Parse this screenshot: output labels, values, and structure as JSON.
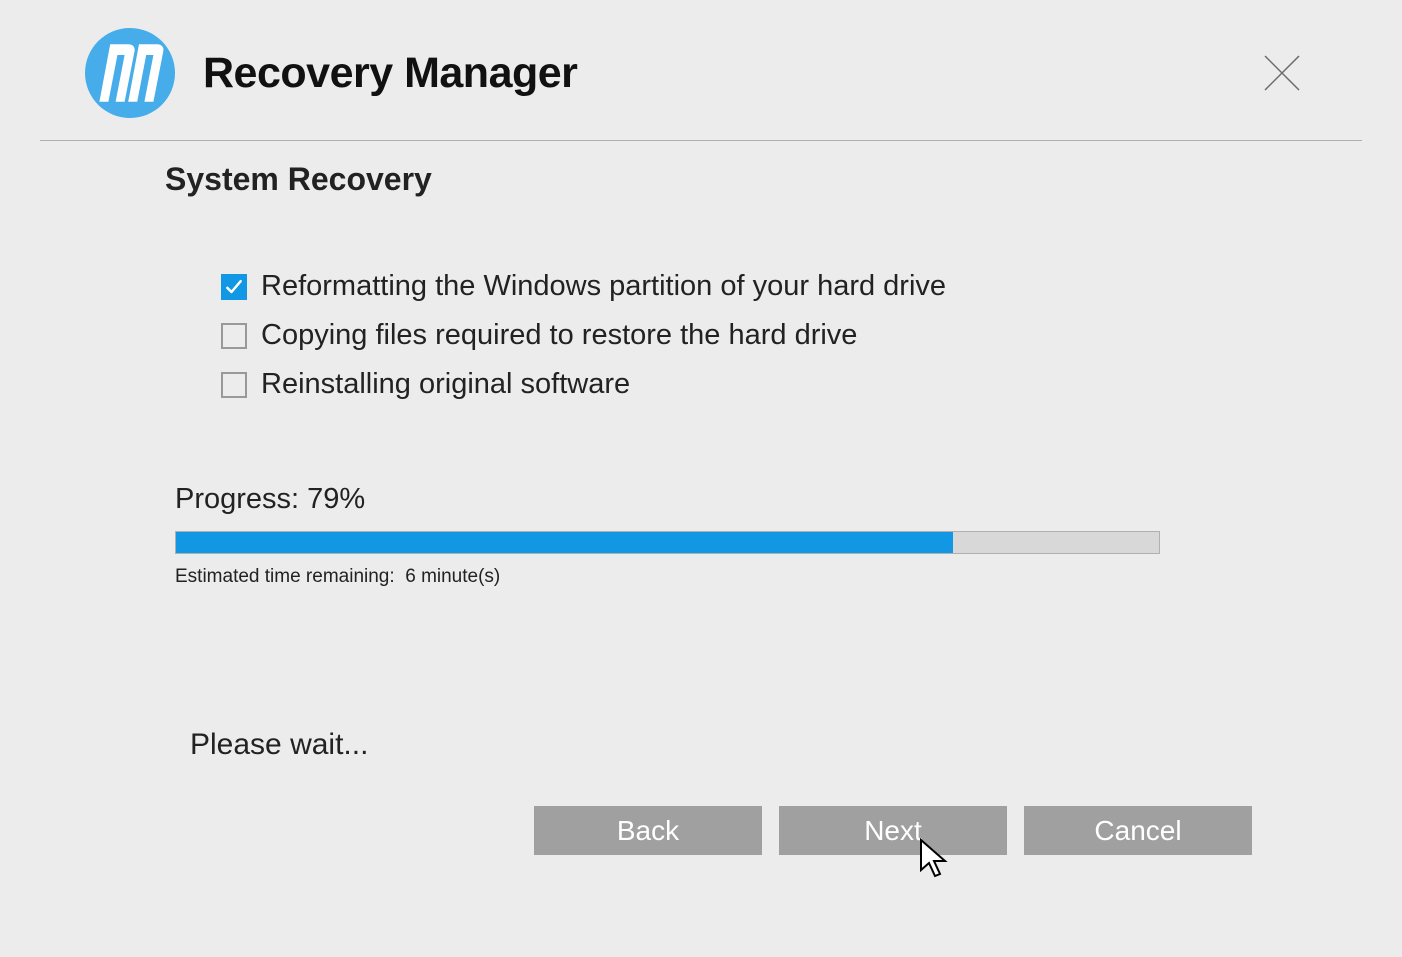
{
  "header": {
    "app_title": "Recovery Manager"
  },
  "main": {
    "section_title": "System Recovery",
    "steps": [
      {
        "label": "Reformatting the Windows partition of your hard drive",
        "done": true
      },
      {
        "label": "Copying files required to restore the hard drive",
        "done": false
      },
      {
        "label": "Reinstalling original software",
        "done": false
      }
    ],
    "progress": {
      "label_prefix": "Progress:",
      "percent": 79,
      "percent_text": "79%",
      "eta_prefix": "Estimated time remaining:",
      "eta_value": "6 minute(s)"
    },
    "wait_message": "Please wait..."
  },
  "buttons": {
    "back": "Back",
    "next": "Next",
    "cancel": "Cancel"
  },
  "colors": {
    "brand": "#1197e3",
    "button_bg": "#a0a0a0"
  }
}
